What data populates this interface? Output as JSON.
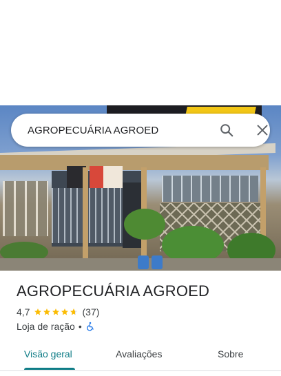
{
  "search": {
    "query": "AGROPECUÁRIA AGROED"
  },
  "place": {
    "title": "AGROPECUÁRIA AGROED",
    "rating": "4,7",
    "stars": 4.7,
    "reviews_count": "(37)",
    "category": "Loja de ração",
    "separator": "•",
    "accessibility_icon": "wheelchair-icon"
  },
  "tabs": [
    {
      "label": "Visão geral",
      "selected": true
    },
    {
      "label": "Avaliações",
      "selected": false
    },
    {
      "label": "Sobre",
      "selected": false
    }
  ],
  "colors": {
    "accent": "#0e7c86",
    "star": "#fbbc04",
    "accessibility": "#1a73e8"
  },
  "icons": {
    "search": "search-icon",
    "close": "close-icon"
  }
}
